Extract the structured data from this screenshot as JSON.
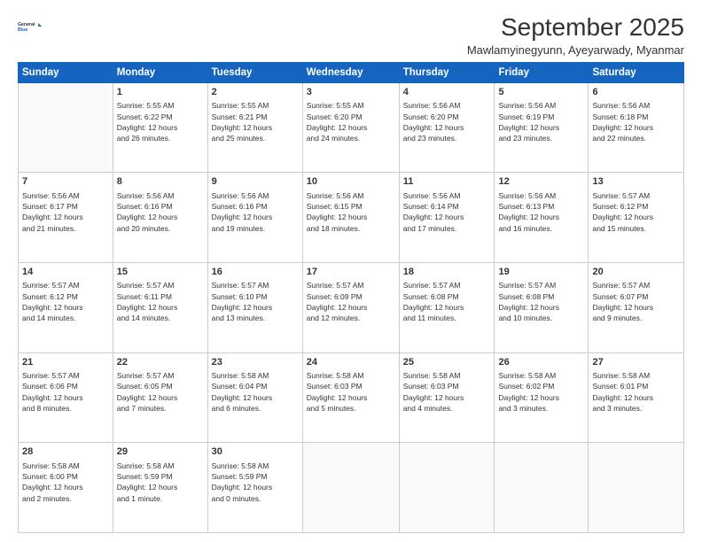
{
  "header": {
    "logo_line1": "General",
    "logo_line2": "Blue",
    "month": "September 2025",
    "location": "Mawlamyinegyunn, Ayeyarwady, Myanmar"
  },
  "weekdays": [
    "Sunday",
    "Monday",
    "Tuesday",
    "Wednesday",
    "Thursday",
    "Friday",
    "Saturday"
  ],
  "weeks": [
    [
      {
        "day": "",
        "info": ""
      },
      {
        "day": "1",
        "info": "Sunrise: 5:55 AM\nSunset: 6:22 PM\nDaylight: 12 hours\nand 26 minutes."
      },
      {
        "day": "2",
        "info": "Sunrise: 5:55 AM\nSunset: 6:21 PM\nDaylight: 12 hours\nand 25 minutes."
      },
      {
        "day": "3",
        "info": "Sunrise: 5:55 AM\nSunset: 6:20 PM\nDaylight: 12 hours\nand 24 minutes."
      },
      {
        "day": "4",
        "info": "Sunrise: 5:56 AM\nSunset: 6:20 PM\nDaylight: 12 hours\nand 23 minutes."
      },
      {
        "day": "5",
        "info": "Sunrise: 5:56 AM\nSunset: 6:19 PM\nDaylight: 12 hours\nand 23 minutes."
      },
      {
        "day": "6",
        "info": "Sunrise: 5:56 AM\nSunset: 6:18 PM\nDaylight: 12 hours\nand 22 minutes."
      }
    ],
    [
      {
        "day": "7",
        "info": "Sunrise: 5:56 AM\nSunset: 6:17 PM\nDaylight: 12 hours\nand 21 minutes."
      },
      {
        "day": "8",
        "info": "Sunrise: 5:56 AM\nSunset: 6:16 PM\nDaylight: 12 hours\nand 20 minutes."
      },
      {
        "day": "9",
        "info": "Sunrise: 5:56 AM\nSunset: 6:16 PM\nDaylight: 12 hours\nand 19 minutes."
      },
      {
        "day": "10",
        "info": "Sunrise: 5:56 AM\nSunset: 6:15 PM\nDaylight: 12 hours\nand 18 minutes."
      },
      {
        "day": "11",
        "info": "Sunrise: 5:56 AM\nSunset: 6:14 PM\nDaylight: 12 hours\nand 17 minutes."
      },
      {
        "day": "12",
        "info": "Sunrise: 5:56 AM\nSunset: 6:13 PM\nDaylight: 12 hours\nand 16 minutes."
      },
      {
        "day": "13",
        "info": "Sunrise: 5:57 AM\nSunset: 6:12 PM\nDaylight: 12 hours\nand 15 minutes."
      }
    ],
    [
      {
        "day": "14",
        "info": "Sunrise: 5:57 AM\nSunset: 6:12 PM\nDaylight: 12 hours\nand 14 minutes."
      },
      {
        "day": "15",
        "info": "Sunrise: 5:57 AM\nSunset: 6:11 PM\nDaylight: 12 hours\nand 14 minutes."
      },
      {
        "day": "16",
        "info": "Sunrise: 5:57 AM\nSunset: 6:10 PM\nDaylight: 12 hours\nand 13 minutes."
      },
      {
        "day": "17",
        "info": "Sunrise: 5:57 AM\nSunset: 6:09 PM\nDaylight: 12 hours\nand 12 minutes."
      },
      {
        "day": "18",
        "info": "Sunrise: 5:57 AM\nSunset: 6:08 PM\nDaylight: 12 hours\nand 11 minutes."
      },
      {
        "day": "19",
        "info": "Sunrise: 5:57 AM\nSunset: 6:08 PM\nDaylight: 12 hours\nand 10 minutes."
      },
      {
        "day": "20",
        "info": "Sunrise: 5:57 AM\nSunset: 6:07 PM\nDaylight: 12 hours\nand 9 minutes."
      }
    ],
    [
      {
        "day": "21",
        "info": "Sunrise: 5:57 AM\nSunset: 6:06 PM\nDaylight: 12 hours\nand 8 minutes."
      },
      {
        "day": "22",
        "info": "Sunrise: 5:57 AM\nSunset: 6:05 PM\nDaylight: 12 hours\nand 7 minutes."
      },
      {
        "day": "23",
        "info": "Sunrise: 5:58 AM\nSunset: 6:04 PM\nDaylight: 12 hours\nand 6 minutes."
      },
      {
        "day": "24",
        "info": "Sunrise: 5:58 AM\nSunset: 6:03 PM\nDaylight: 12 hours\nand 5 minutes."
      },
      {
        "day": "25",
        "info": "Sunrise: 5:58 AM\nSunset: 6:03 PM\nDaylight: 12 hours\nand 4 minutes."
      },
      {
        "day": "26",
        "info": "Sunrise: 5:58 AM\nSunset: 6:02 PM\nDaylight: 12 hours\nand 3 minutes."
      },
      {
        "day": "27",
        "info": "Sunrise: 5:58 AM\nSunset: 6:01 PM\nDaylight: 12 hours\nand 3 minutes."
      }
    ],
    [
      {
        "day": "28",
        "info": "Sunrise: 5:58 AM\nSunset: 6:00 PM\nDaylight: 12 hours\nand 2 minutes."
      },
      {
        "day": "29",
        "info": "Sunrise: 5:58 AM\nSunset: 5:59 PM\nDaylight: 12 hours\nand 1 minute."
      },
      {
        "day": "30",
        "info": "Sunrise: 5:58 AM\nSunset: 5:59 PM\nDaylight: 12 hours\nand 0 minutes."
      },
      {
        "day": "",
        "info": ""
      },
      {
        "day": "",
        "info": ""
      },
      {
        "day": "",
        "info": ""
      },
      {
        "day": "",
        "info": ""
      }
    ]
  ]
}
